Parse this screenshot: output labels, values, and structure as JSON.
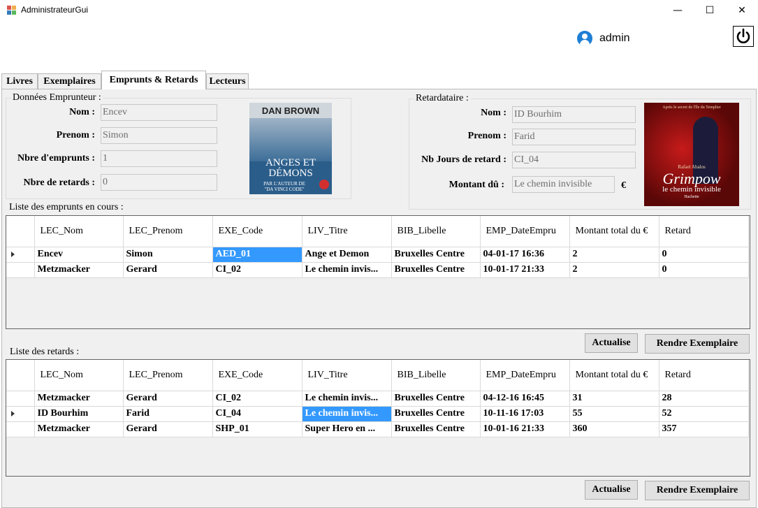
{
  "window": {
    "title": "AdministrateurGui",
    "minimize": "—",
    "maximize": "☐",
    "close": "✕"
  },
  "header": {
    "user": "admin"
  },
  "tabs": [
    "Livres",
    "Exemplaires",
    "Emprunts & Retards",
    "Lecteurs"
  ],
  "emprunteur": {
    "title": "Données Emprunteur :",
    "nom_label": "Nom :",
    "nom": "Encev",
    "prenom_label": "Prenom :",
    "prenom": "Simon",
    "nbre_emprunts_label": "Nbre d'emprunts :",
    "nbre_emprunts": "1",
    "nbre_retards_label": "Nbre de retards :",
    "nbre_retards": "0"
  },
  "cover1": {
    "author": "DAN BROWN",
    "title_line1": "ANGES ET",
    "title_line2": "DÉMONS",
    "sub_line1": "PAR L'AUTEUR DE",
    "sub_line2": "\"DA VINCI CODE\"",
    "color_bg": "#1f4e7a"
  },
  "retardataire": {
    "title": "Retardataire :",
    "nom_label": "Nom :",
    "nom": "ID Bourhim",
    "prenom_label": "Prenom :",
    "prenom": "Farid",
    "jours_label": "Nb Jours de retard :",
    "jours": "CI_04",
    "montant_label": "Montant dû :",
    "montant": "Le chemin invisible",
    "currency": "€"
  },
  "cover2": {
    "top": "Après le secret de l'île du Templier",
    "author": "Rafael Abalos",
    "title": "Grimpow",
    "subtitle": "le chemin invisible",
    "publisher": "Hachette",
    "color_bg": "#7a1010"
  },
  "emprunts": {
    "label": "Liste des emprunts en cours :",
    "columns": [
      "LEC_Nom",
      "LEC_Prenom",
      "EXE_Code",
      "LIV_Titre",
      "BIB_Libelle",
      "EMP_DateEmpru",
      "Montant total du €",
      "Retard"
    ],
    "rows": [
      [
        "Encev",
        "Simon",
        "AED_01",
        "Ange et Demon",
        "Bruxelles Centre",
        "04-01-17 16:36",
        "2",
        "0"
      ],
      [
        "Metzmacker",
        "Gerard",
        "CI_02",
        "Le chemin invis...",
        "Bruxelles Centre",
        "10-01-17 21:33",
        "2",
        "0"
      ]
    ],
    "actualise": "Actualise",
    "rendre": "Rendre Exemplaire"
  },
  "retards": {
    "label": "Liste des retards :",
    "columns": [
      "LEC_Nom",
      "LEC_Prenom",
      "EXE_Code",
      "LIV_Titre",
      "BIB_Libelle",
      "EMP_DateEmpru",
      "Montant total du €",
      "Retard"
    ],
    "rows": [
      [
        "Metzmacker",
        "Gerard",
        "CI_02",
        "Le chemin invis...",
        "Bruxelles Centre",
        "04-12-16 16:45",
        "31",
        "28"
      ],
      [
        "ID Bourhim",
        "Farid",
        "CI_04",
        "Le chemin invis...",
        "Bruxelles Centre",
        "10-11-16 17:03",
        "55",
        "52"
      ],
      [
        "Metzmacker",
        "Gerard",
        "SHP_01",
        "Super Hero en ...",
        "Bruxelles Centre",
        "10-01-16 21:33",
        "360",
        "357"
      ]
    ],
    "actualise": "Actualise",
    "rendre": "Rendre Exemplaire"
  }
}
